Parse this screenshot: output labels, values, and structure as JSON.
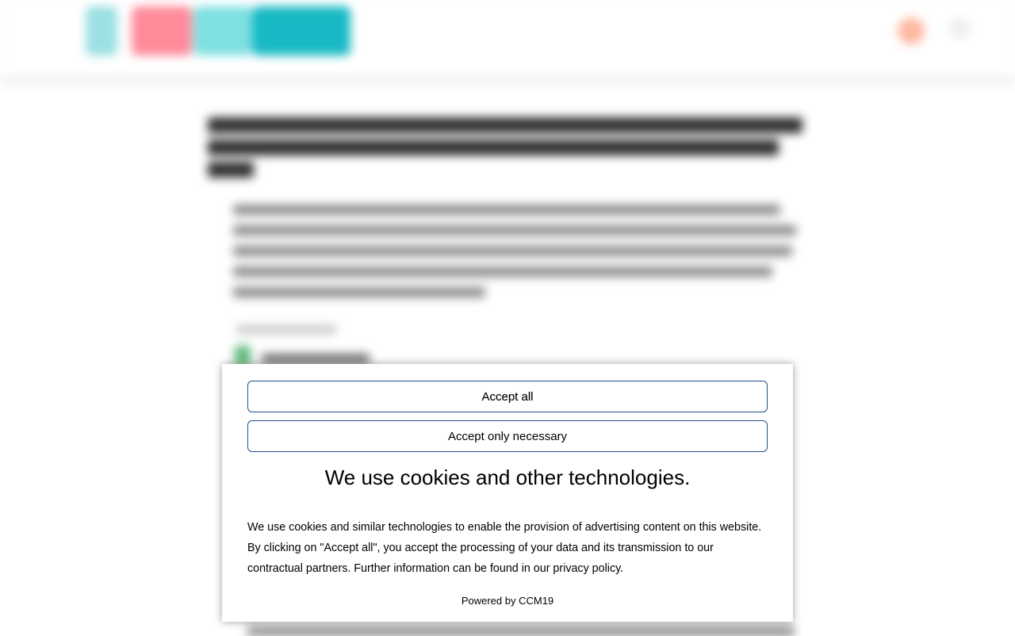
{
  "header": {
    "logo_icon": "site-logo",
    "action_icon": "user-icon"
  },
  "cookie_banner": {
    "accept_all_label": "Accept all",
    "accept_necessary_label": "Accept only necessary",
    "title": "We use cookies and other technologies.",
    "description": "We use cookies and similar technologies to enable the provision of advertising content on this website. By clicking on \"Accept all\", you accept the processing of your data and its transmission to our contractual partners. Further information can be found in our privacy policy.",
    "powered_by": "Powered by CCM19",
    "button_border_color": "#1f4f88"
  }
}
